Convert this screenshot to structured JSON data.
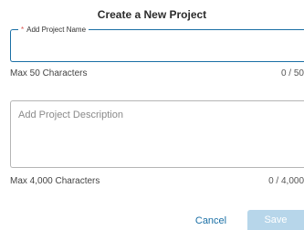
{
  "dialog": {
    "title": "Create a New Project"
  },
  "name_field": {
    "required_marker": "*",
    "label": "Add Project Name",
    "value": "",
    "helper": "Max 50 Characters",
    "counter": "0 / 50"
  },
  "description_field": {
    "placeholder": "Add Project Description",
    "value": "",
    "helper": "Max 4,000 Characters",
    "counter": "0 / 4,000"
  },
  "actions": {
    "cancel_label": "Cancel",
    "save_label": "Save"
  },
  "colors": {
    "accent": "#1a6fa5",
    "save_disabled": "#b7d6ea",
    "required": "#d9534f"
  }
}
